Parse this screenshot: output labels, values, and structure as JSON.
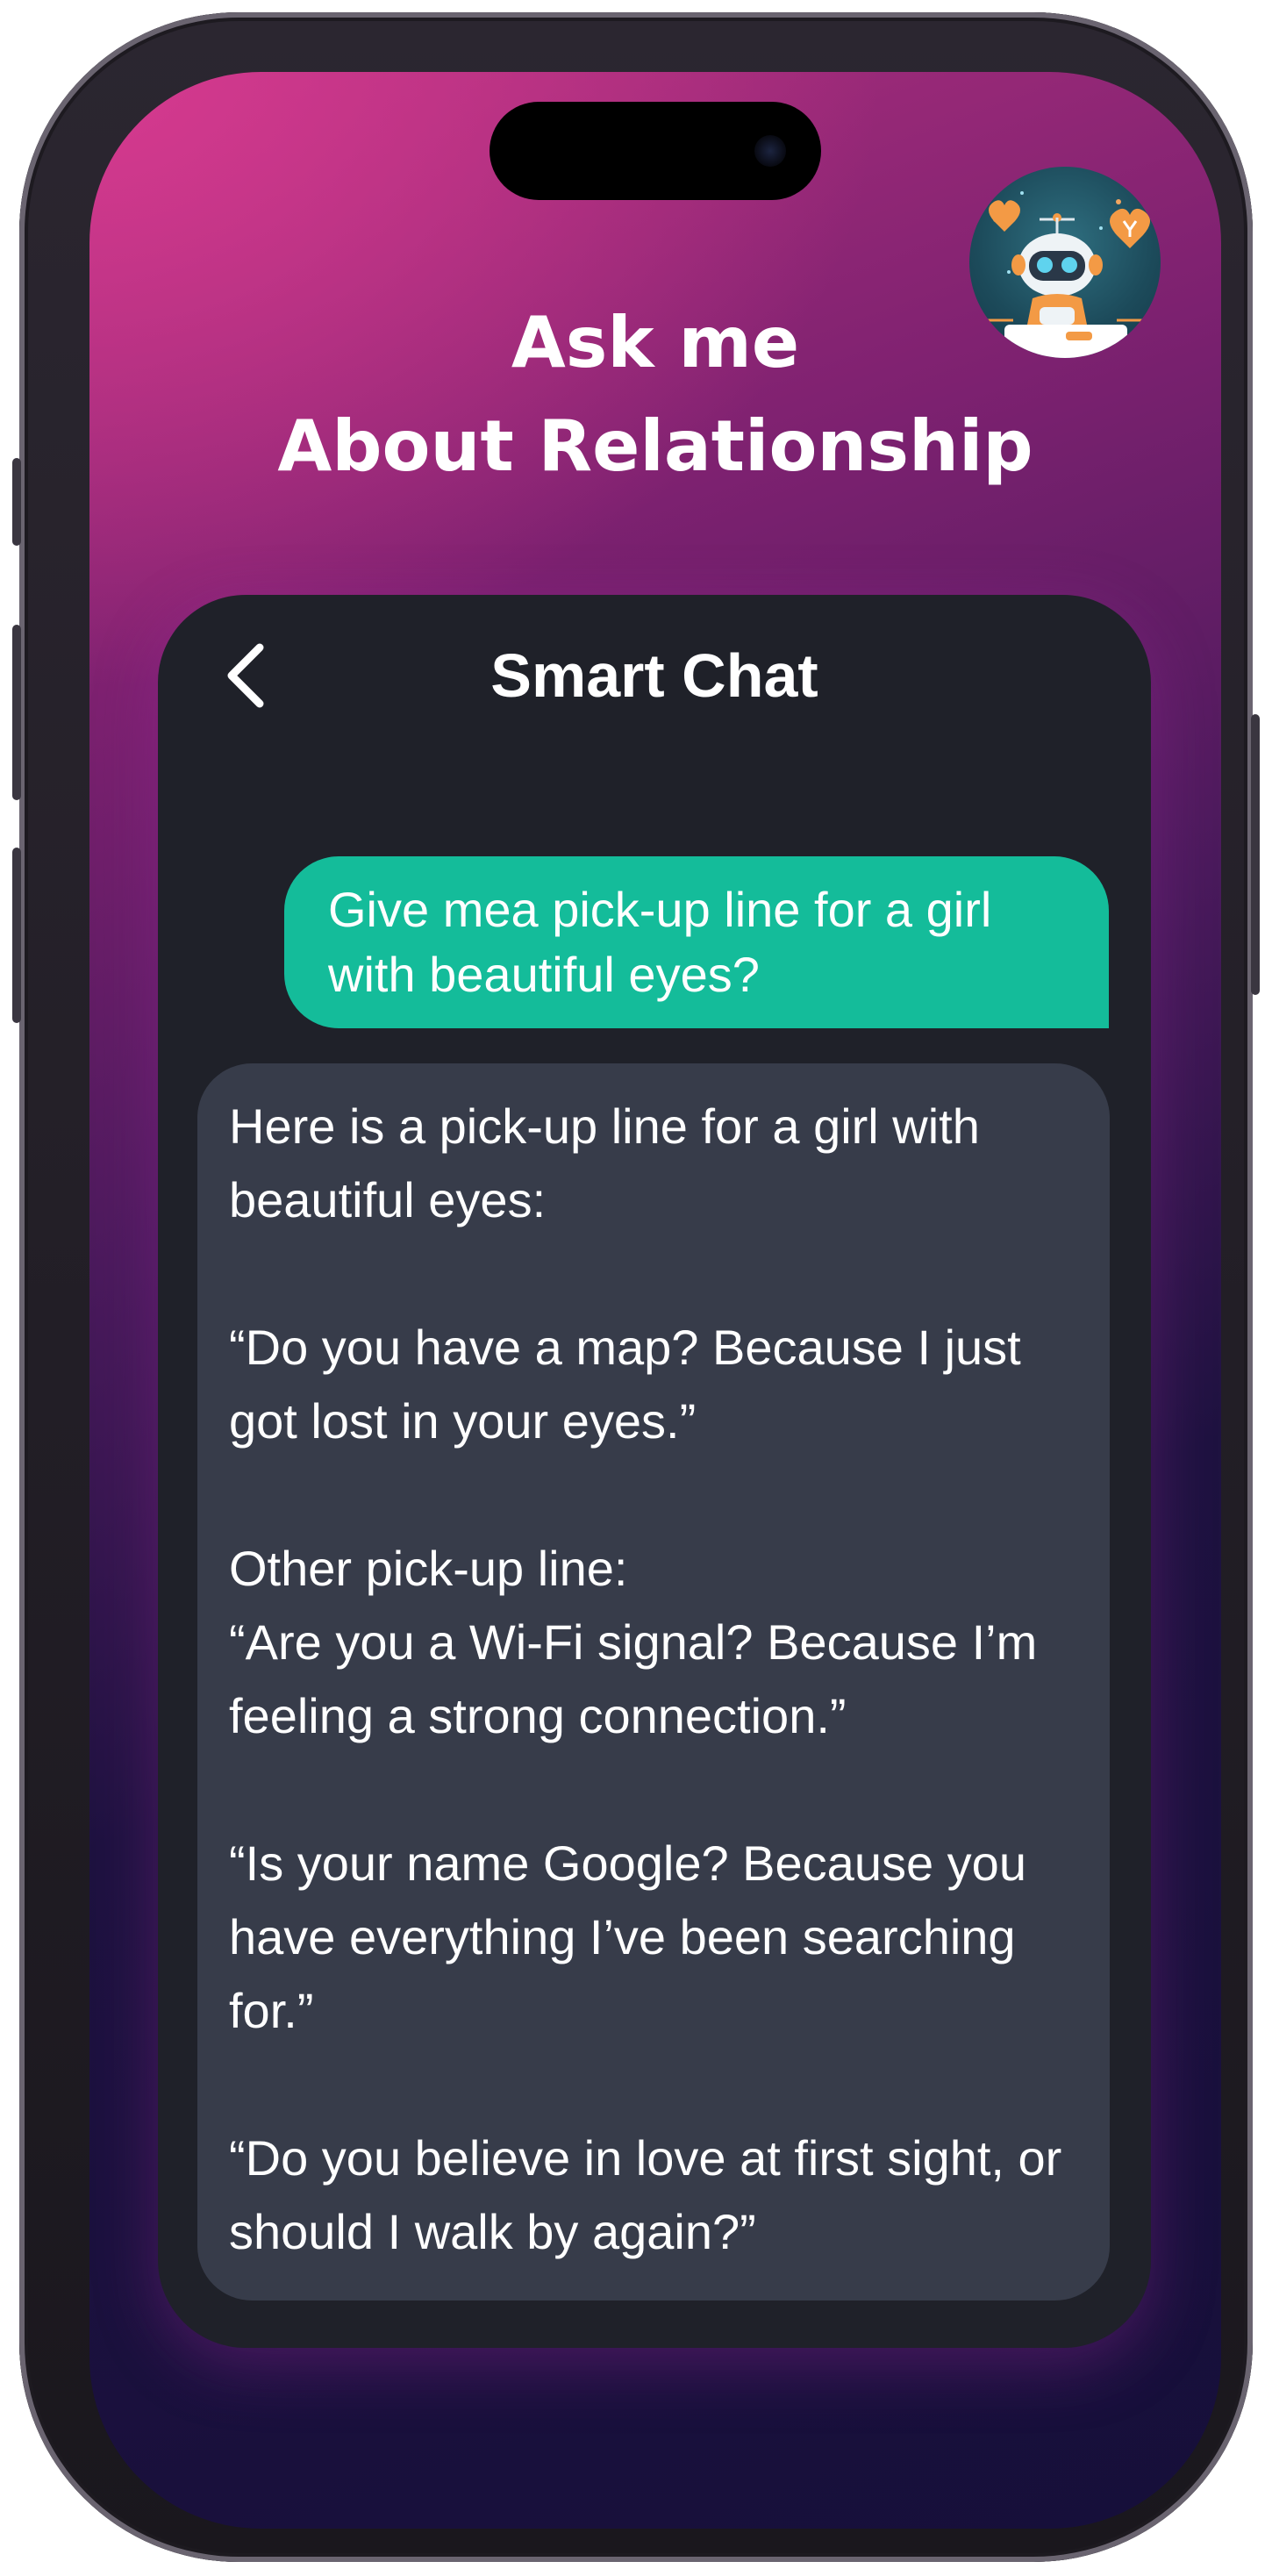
{
  "header": {
    "title_line1": "Ask me",
    "title_line2": "About Relationship",
    "avatar_icon": "robot-with-hearts-avatar-icon"
  },
  "chat": {
    "title": "Smart Chat",
    "back_icon": "chevron-left-icon",
    "messages": [
      {
        "role": "user",
        "text": "Give mea pick-up line for a girl with beautiful eyes?"
      },
      {
        "role": "assistant",
        "paragraphs": [
          "Here is a pick-up line for a girl with beautiful eyes:",
          "“Do you have a map? Because I just got lost in your eyes.”",
          "Other pick-up line:\n“Are you a Wi-Fi signal? Because I’m feeling a strong connection.”",
          "“Is your name Google? Because you have everything I’ve been searching for.”",
          "“Do you believe in love at first sight, or should I walk by again?”"
        ]
      }
    ]
  },
  "colors": {
    "user_bubble": "#14bc9a",
    "assistant_bubble": "#373c4a",
    "card_background": "#1f2129",
    "gradient_top": "#d63a8f",
    "gradient_bottom": "#160f3a"
  }
}
